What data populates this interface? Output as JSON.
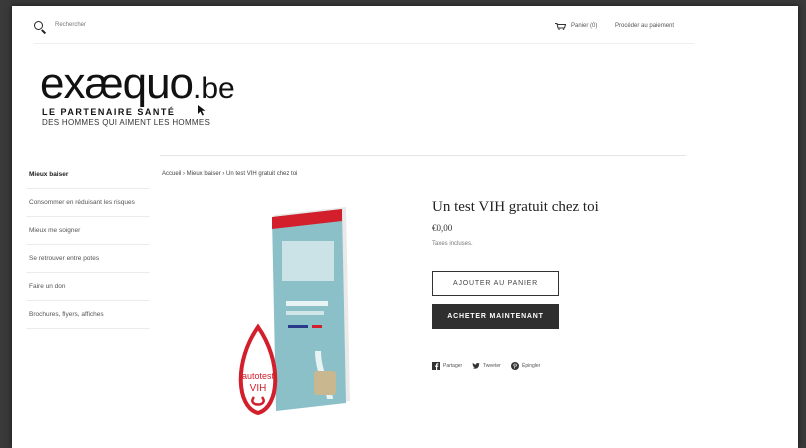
{
  "header": {
    "search_placeholder": "Rechercher",
    "cart_label": "Panier (0)",
    "checkout_label": "Procéder au paiement"
  },
  "logo": {
    "name_main": "exæquo",
    "name_tld": ".be",
    "tagline_1": "LE PARTENAIRE SANTÉ",
    "tagline_2": "DES HOMMES QUI AIMENT LES HOMMES"
  },
  "sidebar": {
    "items": [
      {
        "label": "Mieux baiser",
        "active": true
      },
      {
        "label": "Consommer en réduisant les risques",
        "active": false
      },
      {
        "label": "Mieux me soigner",
        "active": false
      },
      {
        "label": "Se retrouver entre potes",
        "active": false
      },
      {
        "label": "Faire un don",
        "active": false
      },
      {
        "label": "Brochures, flyers, affiches",
        "active": false
      }
    ]
  },
  "breadcrumb": {
    "text": "Accueil › Mieux baiser › Un test VIH gratuit chez toi"
  },
  "product": {
    "title": "Un test VIH gratuit chez toi",
    "price": "€0,00",
    "tax_note": "Taxes incluses.",
    "add_to_cart": "AJOUTER AU PANIER",
    "buy_now": "ACHETER MAINTENANT",
    "image_label": "autotest VIH"
  },
  "share": {
    "facebook": "Partager",
    "twitter": "Tweeter",
    "pinterest": "Épingler"
  },
  "colors": {
    "accent_red": "#d21f2b",
    "box_teal": "#8cc0c8",
    "dark_button": "#2f2f2f"
  }
}
